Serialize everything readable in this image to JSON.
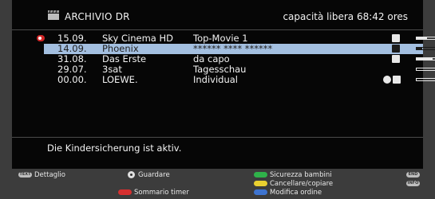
{
  "header": {
    "title": "ARCHIVIO DR",
    "free_space": "capacità libera 68:42 ores",
    "icon": "clapperboard-icon"
  },
  "recordings": [
    {
      "date": "15.09.",
      "channel": "Sky Cinema HD",
      "title": "Top-Movie 1",
      "new": true,
      "status_icon": "key-icon",
      "progress": 0.5
    },
    {
      "date": "14.09.",
      "channel": "Phoenix",
      "title": "****** **** ******",
      "selected": true,
      "status_icon": "lock-icon",
      "progress": 0.25
    },
    {
      "date": "31.08.",
      "channel": "Das Erste",
      "title": "da capo",
      "status_icon": "play-icon",
      "progress": 0.75
    },
    {
      "date": "29.07.",
      "channel": "3sat",
      "title": "Tagesschau",
      "progress": 0.0
    },
    {
      "date": "00.00.",
      "channel": "LOEWE.",
      "title": "Individual",
      "status_icon": "timer-record-icon",
      "progress": 0.0
    }
  ],
  "status_message": "Die Kindersicherung ist aktiv.",
  "footer": {
    "text_key": "TEXT",
    "detail": "Dettaglio",
    "watch": "Guardare",
    "timer_overview": "Sommario timer",
    "child_lock": "Sicurezza bambini",
    "delete_copy": "Cancellare/copiare",
    "change_order": "Modifica ordine",
    "end_key": "END",
    "info_key": "INFO"
  },
  "colors": {
    "selection": "#a3bfe0",
    "red": "#d63030",
    "green": "#2fb24a",
    "yellow": "#e9d030",
    "blue": "#3e74d0"
  }
}
